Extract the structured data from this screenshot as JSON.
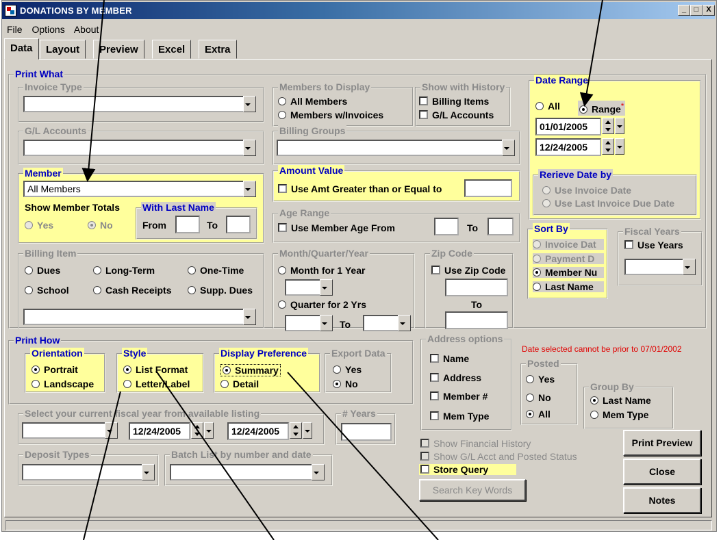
{
  "window": {
    "title": "DONATIONS BY MEMBER",
    "min": "_",
    "max": "□",
    "close": "X"
  },
  "menu": {
    "file": "File",
    "options": "Options",
    "about": "About"
  },
  "tabs": [
    "Data",
    "Layout",
    "Preview",
    "Excel",
    "Extra"
  ],
  "print_what": {
    "label": "Print What",
    "invoice_type": {
      "label": "Invoice Type",
      "value": ""
    },
    "gl_accounts": {
      "label": "G/L Accounts",
      "value": ""
    },
    "member": {
      "label": "Member",
      "value": "All Members",
      "show_totals_label": "Show Member Totals",
      "yes": "Yes",
      "no": "No",
      "selected": "No",
      "last_name_label": "With Last Name",
      "from": "From",
      "to": "To"
    },
    "billing_item": {
      "label": "Billing Item",
      "options": [
        "Dues",
        "Long-Term",
        "One-Time",
        "School",
        "Cash Receipts",
        "Supp. Dues"
      ],
      "value": ""
    },
    "members_to_display": {
      "label": "Members to Display",
      "options": [
        "All Members",
        "Members w/Invoices"
      ]
    },
    "show_with_history": {
      "label": "Show with History",
      "options": [
        "Billing Items",
        "G/L Accounts"
      ]
    },
    "billing_groups": {
      "label": "Billing Groups",
      "value": ""
    },
    "amount_value": {
      "label": "Amount Value",
      "option": "Use Amt Greater than or Equal to"
    },
    "age_range": {
      "label": "Age Range",
      "option": "Use Member Age From",
      "to": "To"
    },
    "month_quarter_year": {
      "label": "Month/Quarter/Year",
      "month": "Month for 1 Year",
      "quarter": "Quarter for 2 Yrs",
      "to": "To"
    },
    "zip_code": {
      "label": "Zip Code",
      "option": "Use Zip Code",
      "to": "To"
    },
    "date_range": {
      "label": "Date Range",
      "all": "All",
      "range": "Range",
      "required": "*",
      "selected": "Range",
      "from": "01/01/2005",
      "to": "12/24/2005",
      "retrieve_label": "Rerieve Date by",
      "retrieve_options": [
        "Use Invoice Date",
        "Use Last Invoice Due Date"
      ]
    },
    "sort_by": {
      "label": "Sort By",
      "options": [
        "Invoice Dat",
        "Payment D",
        "Member Nu",
        "Last Name"
      ],
      "selected": "Member Nu"
    },
    "fiscal_years": {
      "label": "Fiscal Years",
      "option": "Use Years"
    }
  },
  "print_how": {
    "label": "Print How",
    "orientation": {
      "label": "Orientation",
      "options": [
        "Portrait",
        "Landscape"
      ],
      "selected": "Portrait"
    },
    "style": {
      "label": "Style",
      "options": [
        "List Format",
        "Letter/Label"
      ],
      "selected": "List Format"
    },
    "display_preference": {
      "label": "Display Preference",
      "options": [
        "Summary",
        "Detail"
      ],
      "selected": "Summary"
    },
    "export_data": {
      "label": "Export Data",
      "options": [
        "Yes",
        "No"
      ],
      "selected": "No"
    }
  },
  "fiscal_select": {
    "label": "Select  your current fiscal year from available listing",
    "from": "12/24/2005",
    "to": "12/24/2005"
  },
  "years": {
    "label": "# Years"
  },
  "deposit_types": {
    "label": "Deposit Types"
  },
  "batch_list": {
    "label": "Batch List by number and date"
  },
  "address_options": {
    "label": "Address options",
    "options": [
      "Name",
      "Address",
      "Member #",
      "Mem Type"
    ]
  },
  "warning": "Date selected cannot be prior to 07/01/2002",
  "posted": {
    "label": "Posted",
    "options": [
      "Yes",
      "No",
      "All"
    ],
    "selected": "All"
  },
  "group_by": {
    "label": "Group By",
    "options": [
      "Last Name",
      "Mem Type"
    ],
    "selected": "Last Name"
  },
  "checks": {
    "financial_history": "Show Financial History",
    "gl_posted": "Show G/L Acct and Posted Status",
    "store_query": "Store Query"
  },
  "buttons": {
    "search": "Search Key Words",
    "print_preview": "Print Preview",
    "close": "Close",
    "notes": "Notes"
  },
  "colors": {
    "highlight": "#ffff9c",
    "legend_blue": "#0000c0",
    "face": "#d4d0c8",
    "title_start": "#0a246a",
    "warning": "#e00000"
  }
}
